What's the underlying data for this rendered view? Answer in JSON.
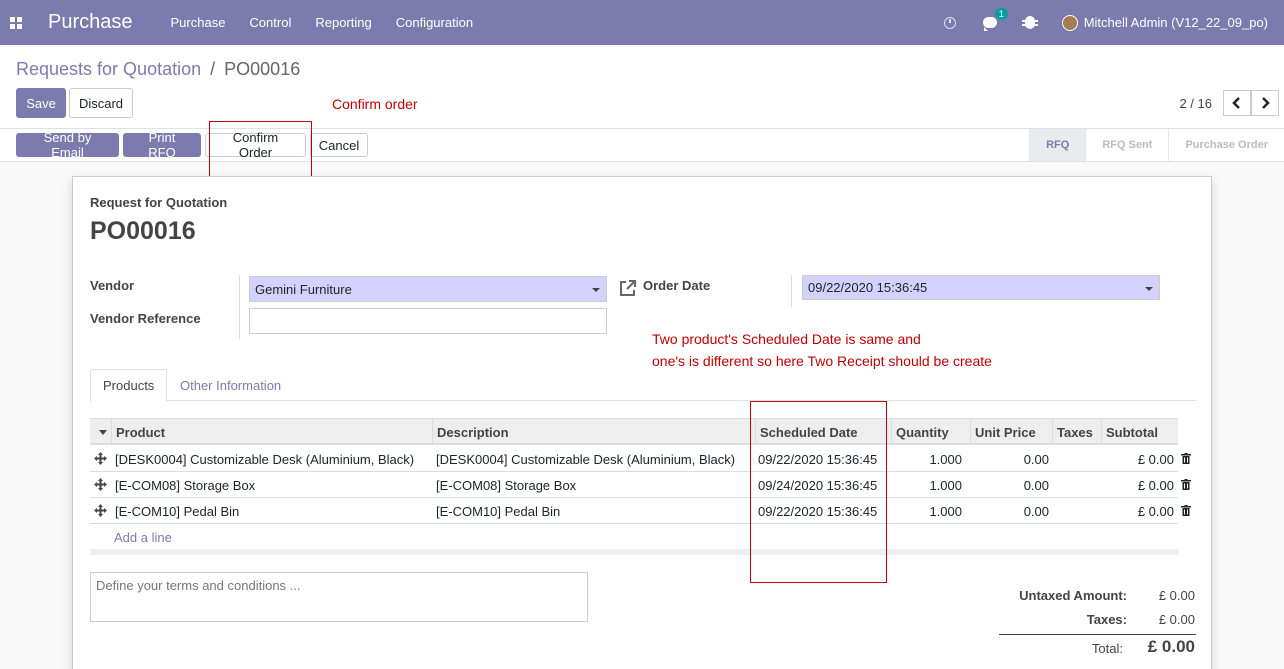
{
  "navbar": {
    "app_title": "Purchase",
    "menu": [
      "Purchase",
      "Control",
      "Reporting",
      "Configuration"
    ],
    "chat_badge": "1",
    "user": "Mitchell Admin (V12_22_09_po)"
  },
  "control": {
    "breadcrumb_parent": "Requests for Quotation",
    "breadcrumb_sep": "/",
    "breadcrumb_current": "PO00016",
    "save_label": "Save",
    "discard_label": "Discard",
    "pager": "2 / 16"
  },
  "annotations": {
    "confirm_note": "Confirm order",
    "date_note_line1": "Two product's Scheduled Date is same and",
    "date_note_line2": "one's is different so here Two Receipt should be create"
  },
  "statusbar": {
    "send_email": "Send by Email",
    "print_rfq": "Print RFQ",
    "confirm_order": "Confirm Order",
    "cancel": "Cancel",
    "stages": [
      "RFQ",
      "RFQ Sent",
      "Purchase Order"
    ],
    "active_stage": "RFQ"
  },
  "form": {
    "subtitle": "Request for Quotation",
    "title": "PO00016",
    "vendor_label": "Vendor",
    "vendor_value": "Gemini Furniture",
    "vendor_ref_label": "Vendor Reference",
    "vendor_ref_value": "",
    "order_date_label": "Order Date",
    "order_date_value": "09/22/2020 15:36:45"
  },
  "tabs": [
    "Products",
    "Other Information"
  ],
  "table": {
    "headers": [
      "Product",
      "Description",
      "Scheduled Date",
      "Quantity",
      "Unit Price",
      "Taxes",
      "Subtotal"
    ],
    "rows": [
      {
        "product": "[DESK0004] Customizable Desk (Aluminium, Black)",
        "description": "[DESK0004] Customizable Desk (Aluminium, Black)",
        "date": "09/22/2020 15:36:45",
        "qty": "1.000",
        "price": "0.00",
        "taxes": "",
        "subtotal": "£ 0.00"
      },
      {
        "product": "[E-COM08] Storage Box",
        "description": "[E-COM08] Storage Box",
        "date": "09/24/2020 15:36:45",
        "qty": "1.000",
        "price": "0.00",
        "taxes": "",
        "subtotal": "£ 0.00"
      },
      {
        "product": "[E-COM10] Pedal Bin",
        "description": "[E-COM10] Pedal Bin",
        "date": "09/22/2020 15:36:45",
        "qty": "1.000",
        "price": "0.00",
        "taxes": "",
        "subtotal": "£ 0.00"
      }
    ],
    "add_line": "Add a line"
  },
  "notes_placeholder": "Define your terms and conditions ...",
  "totals": {
    "untaxed_label": "Untaxed Amount:",
    "untaxed_value": "£ 0.00",
    "taxes_label": "Taxes:",
    "taxes_value": "£ 0.00",
    "total_label": "Total:",
    "total_value": "£ 0.00"
  },
  "colors": {
    "brand": "#7c7bad",
    "annotation": "#c00000",
    "highlight_field": "#d2d2ff"
  }
}
